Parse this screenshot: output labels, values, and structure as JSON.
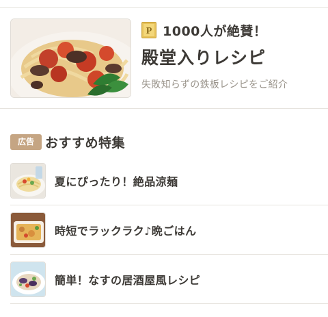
{
  "hall_of_fame": {
    "catch": "1000人が絶賛！",
    "title": "殿堂入りレシピ",
    "description": "失敗知らずの鉄板レシピをご紹介",
    "premium_icon_letter": "P",
    "premium_icon_color": "#e6c15a",
    "image_icon": "pasta-image"
  },
  "ad_section": {
    "badge": "広告",
    "badge_color": "#c5a583",
    "title": "おすすめ特集",
    "items": [
      {
        "label": "夏にぴったり！絶品涼麺",
        "image_icon": "cold-noodles-image"
      },
      {
        "label": "時短でラックラク♪晩ごはん",
        "image_icon": "gratin-image"
      },
      {
        "label": "簡単！なすの居酒屋風レシピ",
        "image_icon": "eggplant-dish-image"
      }
    ]
  },
  "colors": {
    "text": "#3d3a36",
    "subtext": "#9a948b",
    "divider": "#e6e3de"
  }
}
